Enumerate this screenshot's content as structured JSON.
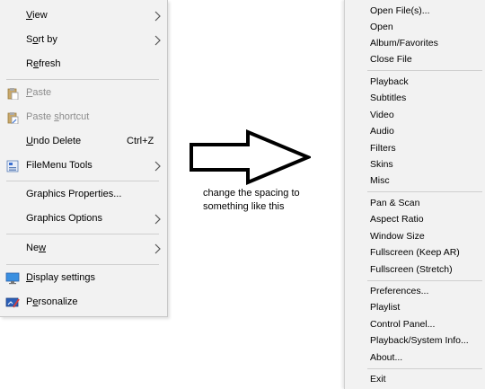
{
  "context_menu": {
    "items": [
      {
        "pre": "",
        "u": "V",
        "post": "iew",
        "shortcut": "",
        "has_submenu": true,
        "disabled": false,
        "icon": ""
      },
      {
        "pre": "S",
        "u": "o",
        "post": "rt by",
        "shortcut": "",
        "has_submenu": true,
        "disabled": false,
        "icon": ""
      },
      {
        "pre": "R",
        "u": "e",
        "post": "fresh",
        "shortcut": "",
        "has_submenu": false,
        "disabled": false,
        "icon": ""
      },
      {
        "pre": "",
        "u": "P",
        "post": "aste",
        "shortcut": "",
        "has_submenu": false,
        "disabled": true,
        "icon": "clipboard-icon"
      },
      {
        "pre": "Paste ",
        "u": "s",
        "post": "hortcut",
        "shortcut": "",
        "has_submenu": false,
        "disabled": true,
        "icon": "clipboard-shortcut-icon"
      },
      {
        "pre": "",
        "u": "U",
        "post": "ndo Delete",
        "shortcut": "Ctrl+Z",
        "has_submenu": false,
        "disabled": false,
        "icon": ""
      },
      {
        "pre": "FileMenu Tools",
        "u": "",
        "post": "",
        "shortcut": "",
        "has_submenu": true,
        "disabled": false,
        "icon": "filemenu-tools-icon"
      },
      {
        "pre": "Graphics Properties...",
        "u": "",
        "post": "",
        "shortcut": "",
        "has_submenu": false,
        "disabled": false,
        "icon": ""
      },
      {
        "pre": "Graphics Options",
        "u": "",
        "post": "",
        "shortcut": "",
        "has_submenu": true,
        "disabled": false,
        "icon": ""
      },
      {
        "pre": "Ne",
        "u": "w",
        "post": "",
        "shortcut": "",
        "has_submenu": true,
        "disabled": false,
        "icon": ""
      },
      {
        "pre": "",
        "u": "D",
        "post": "isplay settings",
        "shortcut": "",
        "has_submenu": false,
        "disabled": false,
        "icon": "display-settings-icon"
      },
      {
        "pre": "P",
        "u": "e",
        "post": "rsonalize",
        "shortcut": "",
        "has_submenu": false,
        "disabled": false,
        "icon": "personalize-icon"
      }
    ]
  },
  "caption": "change the spacing to something like this",
  "player_menu": {
    "groups": [
      [
        "Open File(s)...",
        "Open",
        "Album/Favorites",
        "Close File"
      ],
      [
        "Playback",
        "Subtitles",
        "Video",
        "Audio",
        "Filters",
        "Skins",
        "Misc"
      ],
      [
        "Pan & Scan",
        "Aspect Ratio",
        "Window Size",
        "Fullscreen (Keep AR)",
        "Fullscreen (Stretch)"
      ],
      [
        "Preferences...",
        "Playlist",
        "Control Panel...",
        "Playback/System Info...",
        "About..."
      ],
      [
        "Exit"
      ]
    ]
  },
  "colors": {
    "menu_bg": "#f2f2f2",
    "disabled_text": "#8c8c8c",
    "separator": "#cfcfcf"
  }
}
